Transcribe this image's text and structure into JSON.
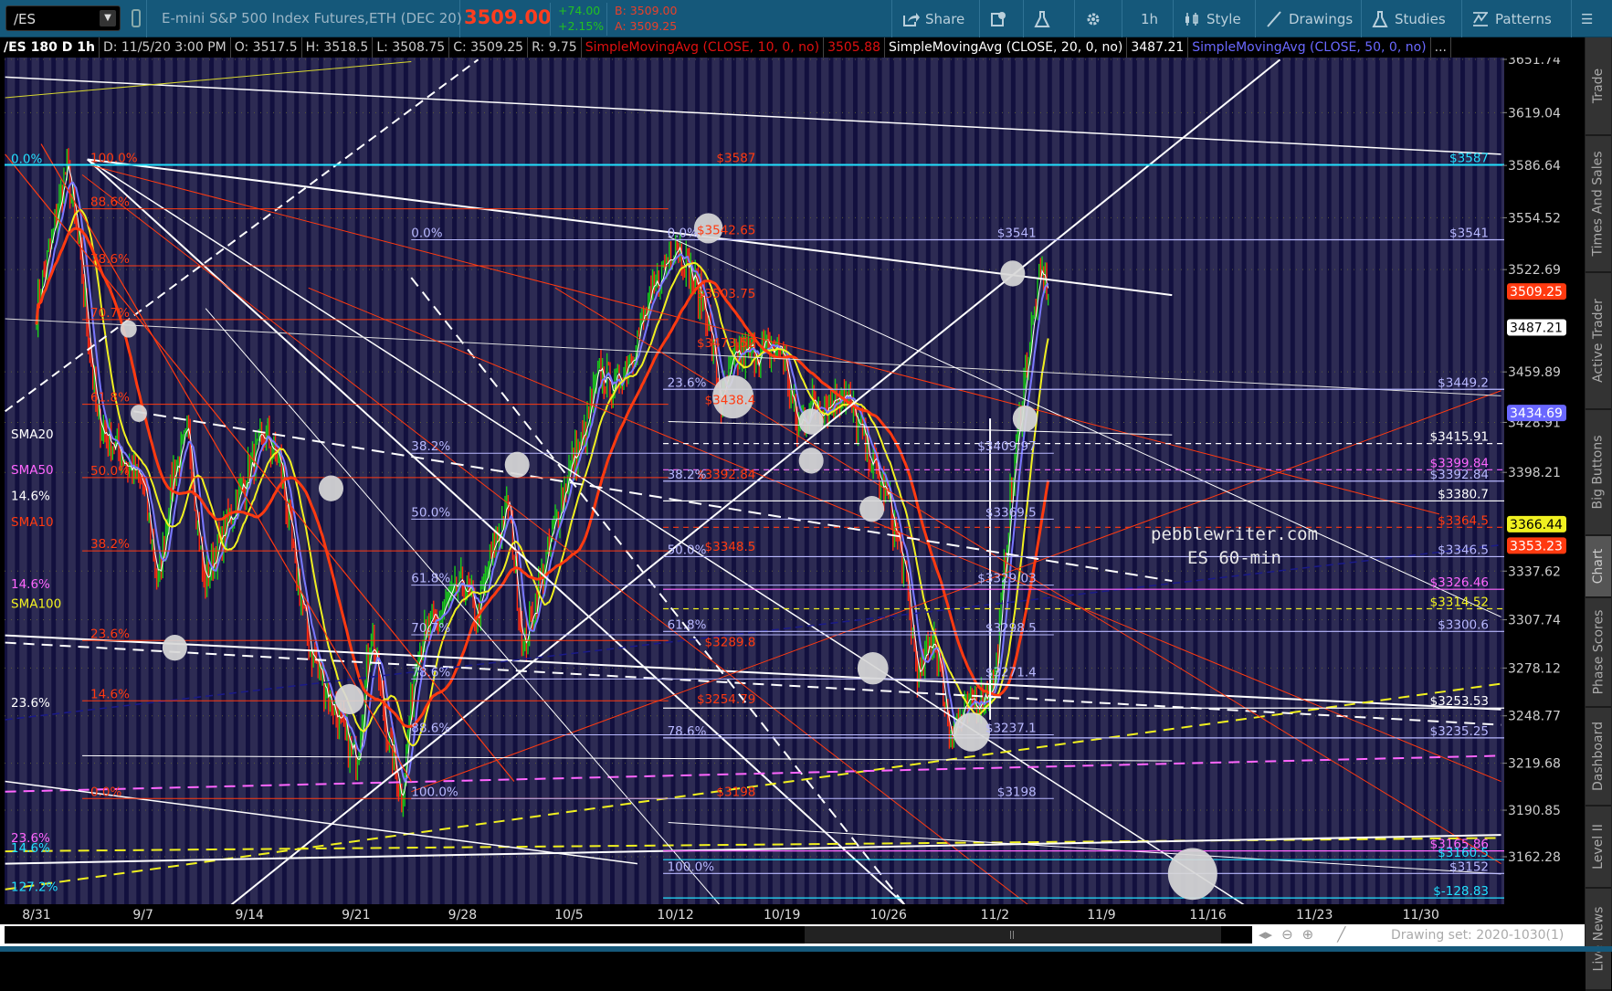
{
  "toolbar": {
    "symbol": "/ES",
    "description": "E-mini S&P 500 Index Futures,ETH (DEC 20)",
    "last": "3509.00",
    "change": "+74.00",
    "change_pct": "+2.15%",
    "bid": "B: 3509.00",
    "ask": "A: 3509.25",
    "buttons": {
      "share": "Share",
      "timeframe": "1h",
      "style": "Style",
      "drawings": "Drawings",
      "studies": "Studies",
      "patterns": "Patterns"
    }
  },
  "infobar": {
    "title": "/ES 180 D 1h",
    "date": "D: 11/5/20 3:00 PM",
    "open": "O: 3517.5",
    "high": "H: 3518.5",
    "low": "L: 3508.75",
    "close": "C: 3509.25",
    "range": "R: 9.75",
    "sma10": "SimpleMovingAvg (CLOSE, 10, 0, no)",
    "sma10_val": "3505.88",
    "sma20": "SimpleMovingAvg (CLOSE, 20, 0, no)",
    "sma20_val": "3487.21",
    "sma50": "SimpleMovingAvg (CLOSE, 50, 0, no)",
    "more": "..."
  },
  "side_tabs": [
    "Trade",
    "Times And Sales",
    "Active Trader",
    "Big Buttons",
    "Chart",
    "Phase Scores",
    "Dashboard",
    "Level II",
    "Live News"
  ],
  "bottom": {
    "drawing_set": "Drawing set: 2020-1030(1)"
  },
  "watermark": {
    "line1": "pebblewriter.com",
    "line2": "ES 60-min"
  },
  "colors": {
    "toolbar": "#15587a",
    "up": "#19c919",
    "down": "#ff2a10",
    "sma10": "#ff3a10",
    "sma20": "#f0f020",
    "sma50": "#7a78ff",
    "fib_red": "#ff3a10",
    "fib_lav": "#b8b8ff"
  },
  "chart_data": {
    "type": "candlestick",
    "x_axis": {
      "ticks": [
        {
          "label": "8/31",
          "day": 0
        },
        {
          "label": "9/7",
          "day": 7
        },
        {
          "label": "9/14",
          "day": 14
        },
        {
          "label": "9/21",
          "day": 21
        },
        {
          "label": "9/28",
          "day": 28
        },
        {
          "label": "10/5",
          "day": 35
        },
        {
          "label": "10/12",
          "day": 42
        },
        {
          "label": "10/19",
          "day": 49
        },
        {
          "label": "10/26",
          "day": 56
        },
        {
          "label": "11/2",
          "day": 63
        },
        {
          "label": "11/9",
          "day": 70
        },
        {
          "label": "11/16",
          "day": 77
        },
        {
          "label": "11/23",
          "day": 84
        },
        {
          "label": "11/30",
          "day": 91
        }
      ]
    },
    "y_axis": {
      "ticks": [
        "3651.74",
        "3619.04",
        "3586.64",
        "3554.52",
        "3522.69",
        "3459.89",
        "3428.91",
        "3398.21",
        "3337.62",
        "3307.74",
        "3278.12",
        "3248.77",
        "3219.68",
        "3190.85",
        "3162.28"
      ]
    },
    "badges": [
      {
        "value": "3509.25",
        "bg": "#ff3a10",
        "fg": "#fff"
      },
      {
        "value": "3487.21",
        "bg": "#ffffff",
        "fg": "#000"
      },
      {
        "value": "3434.69",
        "bg": "#6a68ff",
        "fg": "#fff"
      },
      {
        "value": "3366.44",
        "bg": "#f0f020",
        "fg": "#000"
      },
      {
        "value": "3353.23",
        "bg": "#ff3a10",
        "fg": "#fff"
      }
    ],
    "price_path": [
      [
        0,
        3500
      ],
      [
        1,
        3540
      ],
      [
        2,
        3587
      ],
      [
        3,
        3520
      ],
      [
        4,
        3430
      ],
      [
        7,
        3390
      ],
      [
        8,
        3330
      ],
      [
        9,
        3400
      ],
      [
        10,
        3420
      ],
      [
        11,
        3330
      ],
      [
        14,
        3400
      ],
      [
        15,
        3420
      ],
      [
        16,
        3405
      ],
      [
        17,
        3340
      ],
      [
        18,
        3290
      ],
      [
        21,
        3220
      ],
      [
        22,
        3300
      ],
      [
        23,
        3240
      ],
      [
        24,
        3200
      ],
      [
        25,
        3290
      ],
      [
        28,
        3330
      ],
      [
        29,
        3310
      ],
      [
        30,
        3350
      ],
      [
        31,
        3380
      ],
      [
        32,
        3290
      ],
      [
        35,
        3400
      ],
      [
        36,
        3420
      ],
      [
        37,
        3460
      ],
      [
        38,
        3450
      ],
      [
        39,
        3470
      ],
      [
        42,
        3542
      ],
      [
        43,
        3520
      ],
      [
        44,
        3500
      ],
      [
        45,
        3440
      ],
      [
        46,
        3470
      ],
      [
        49,
        3475
      ],
      [
        50,
        3425
      ],
      [
        51,
        3440
      ],
      [
        52,
        3440
      ],
      [
        53,
        3450
      ],
      [
        56,
        3380
      ],
      [
        57,
        3340
      ],
      [
        58,
        3270
      ],
      [
        59,
        3300
      ],
      [
        60,
        3240
      ],
      [
        63,
        3270
      ],
      [
        64,
        3380
      ],
      [
        65,
        3460
      ],
      [
        66,
        3520
      ],
      [
        66.6,
        3509.25
      ]
    ],
    "left_labels": [
      {
        "text": "0.0%",
        "price": 3587,
        "color": "#22e0ff"
      },
      {
        "text": "SMA20",
        "price": 3418,
        "color": "#ffffff"
      },
      {
        "text": "SMA50",
        "price": 3396,
        "color": "#ff66ff"
      },
      {
        "text": "14.6%",
        "price": 3380,
        "color": "#ffffff"
      },
      {
        "text": "SMA10",
        "price": 3364,
        "color": "#ff3a10"
      },
      {
        "text": "14.6%",
        "price": 3326,
        "color": "#ff66ff"
      },
      {
        "text": "SMA100",
        "price": 3314,
        "color": "#f0f020"
      },
      {
        "text": "23.6%",
        "price": 3253,
        "color": "#ffffff"
      },
      {
        "text": "23.6%",
        "price": 3170,
        "color": "#ff66ff"
      },
      {
        "text": "14.6%",
        "price": 3164,
        "color": "#22e0ff"
      },
      {
        "text": "127.2%",
        "price": 3140,
        "color": "#22e0ff"
      }
    ],
    "red_fib": [
      {
        "text": "100.0%",
        "price": 3587
      },
      {
        "text": "88.6%",
        "price": 3560
      },
      {
        "text": "78.6%",
        "price": 3525
      },
      {
        "text": "70.7%",
        "price": 3492
      },
      {
        "text": "61.8%",
        "price": 3440
      },
      {
        "text": "50.0%",
        "price": 3395
      },
      {
        "text": "38.2%",
        "price": 3350
      },
      {
        "text": "23.6%",
        "price": 3295
      },
      {
        "text": "14.6%",
        "price": 3258
      },
      {
        "text": "0.0%",
        "price": 3198
      }
    ],
    "red_prices": [
      {
        "text": "$3587",
        "price": 3587
      },
      {
        "text": "$3542.65",
        "price": 3542.65
      },
      {
        "text": "$3503.75",
        "price": 3503.75
      },
      {
        "text": "$3473.52",
        "price": 3473.52
      },
      {
        "text": "$3438.4",
        "price": 3438.4
      },
      {
        "text": "$3392.84",
        "price": 3392.84
      },
      {
        "text": "$3348.5",
        "price": 3348.5
      },
      {
        "text": "$3289.8",
        "price": 3289.8
      },
      {
        "text": "$3254.79",
        "price": 3254.79
      },
      {
        "text": "$3198",
        "price": 3198
      }
    ],
    "lav_fib_a": [
      {
        "text": "0.0%",
        "price": 3541
      },
      {
        "text": "38.2%",
        "price": 3409.97
      },
      {
        "text": "50.0%",
        "price": 3369.5
      },
      {
        "text": "61.8%",
        "price": 3329.03
      },
      {
        "text": "70.7%",
        "price": 3298.5
      },
      {
        "text": "78.6%",
        "price": 3271.4
      },
      {
        "text": "88.6%",
        "price": 3237.1
      },
      {
        "text": "100.0%",
        "price": 3198
      }
    ],
    "lav_fib_b": [
      {
        "text": "0.0%",
        "price": 3541
      },
      {
        "text": "23.6%",
        "price": 3449.2
      },
      {
        "text": "38.2%",
        "price": 3392.84
      },
      {
        "text": "50.0%",
        "price": 3346.5
      },
      {
        "text": "61.8%",
        "price": 3300.6
      },
      {
        "text": "78.6%",
        "price": 3235.25
      },
      {
        "text": "100.0%",
        "price": 3152
      }
    ],
    "lav_prices": [
      {
        "text": "$3541",
        "price": 3541
      },
      {
        "text": "$3409.97",
        "price": 3409.97
      },
      {
        "text": "$3369.5",
        "price": 3369.5
      },
      {
        "text": "$3329.03",
        "price": 3329.03
      },
      {
        "text": "$3298.5",
        "price": 3298.5
      },
      {
        "text": "$3271.4",
        "price": 3271.4
      },
      {
        "text": "$3237.1",
        "price": 3237.1
      },
      {
        "text": "$3198",
        "price": 3198
      }
    ],
    "right_levels": [
      {
        "text": "$3587",
        "price": 3587,
        "color": "#22e0ff"
      },
      {
        "text": "$3541",
        "price": 3541,
        "color": "#b8b8ff"
      },
      {
        "text": "$3449.2",
        "price": 3449.2,
        "color": "#b8b8ff"
      },
      {
        "text": "$3415.91",
        "price": 3415.91,
        "color": "#ffffff"
      },
      {
        "text": "$3399.84",
        "price": 3399.84,
        "color": "#ff66ff"
      },
      {
        "text": "$3392.84",
        "price": 3392.84,
        "color": "#b8b8ff"
      },
      {
        "text": "$3380.7",
        "price": 3380.7,
        "color": "#ffffff"
      },
      {
        "text": "$3364.5",
        "price": 3364.5,
        "color": "#ff3a10"
      },
      {
        "text": "$3346.5",
        "price": 3346.5,
        "color": "#b8b8ff"
      },
      {
        "text": "$3326.46",
        "price": 3326.46,
        "color": "#ff66ff"
      },
      {
        "text": "$3314.52",
        "price": 3314.52,
        "color": "#f0f020"
      },
      {
        "text": "$3300.6",
        "price": 3300.6,
        "color": "#b8b8ff"
      },
      {
        "text": "$3253.53",
        "price": 3253.53,
        "color": "#ffffff"
      },
      {
        "text": "$3235.25",
        "price": 3235.25,
        "color": "#b8b8ff"
      },
      {
        "text": "$3165.86",
        "price": 3165.86,
        "color": "#ff66ff"
      },
      {
        "text": "$3160.5",
        "price": 3160.5,
        "color": "#22e0ff"
      },
      {
        "text": "$3152",
        "price": 3152,
        "color": "#b8b8ff"
      },
      {
        "text": "$-128.83",
        "price": 3137,
        "color": "#22e0ff"
      }
    ]
  }
}
